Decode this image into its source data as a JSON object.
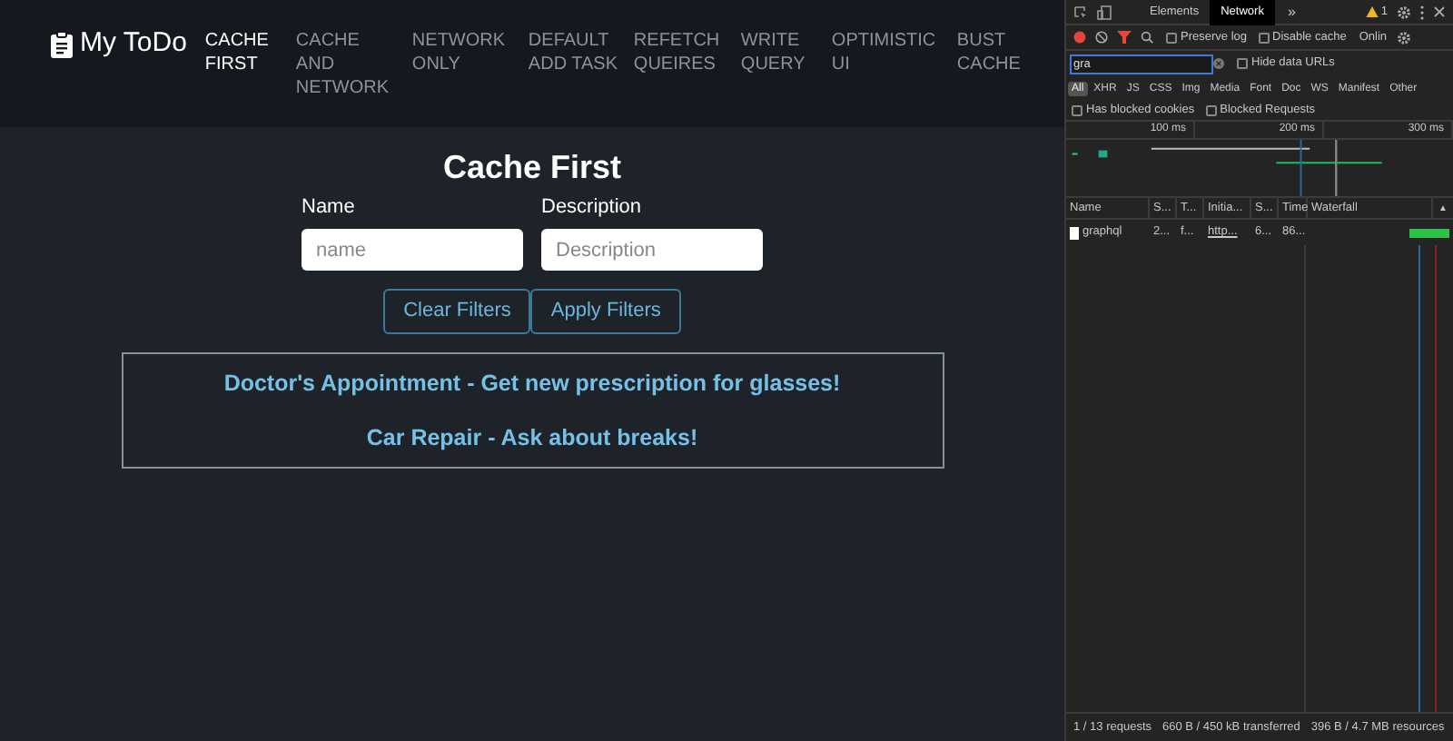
{
  "app": {
    "brand": "My ToDo",
    "nav": [
      {
        "label": "CACHE FIRST",
        "selected": true
      },
      {
        "label": "CACHE AND NETWORK",
        "selected": false
      },
      {
        "label": "NETWORK ONLY",
        "selected": false
      },
      {
        "label": "DEFAULT ADD TASK",
        "selected": false
      },
      {
        "label": "REFETCH QUEIRES",
        "selected": false
      },
      {
        "label": "WRITE QUERY",
        "selected": false
      },
      {
        "label": "OPTIMISTIC UI",
        "selected": false
      },
      {
        "label": "BUST CACHE",
        "selected": false
      }
    ],
    "heading": "Cache First",
    "fields": [
      {
        "label": "Name",
        "placeholder": "name"
      },
      {
        "label": "Description",
        "placeholder": "Description"
      }
    ],
    "buttons": [
      "Clear Filters",
      "Apply Filters"
    ],
    "tasks": [
      "Doctor's Appointment - Get new prescription for glasses!",
      "Car Repair - Ask about breaks!"
    ]
  },
  "devtools": {
    "tabs": [
      {
        "label": "Elements",
        "selected": false
      },
      {
        "label": "Network",
        "selected": true
      }
    ],
    "more": "»",
    "warnings": "1",
    "options": [
      {
        "label": "Preserve log",
        "checked": false
      },
      {
        "label": "Disable cache",
        "checked": false
      }
    ],
    "throttle": "Onlin",
    "filter": {
      "value": "gra"
    },
    "hide_data_urls": {
      "label": "Hide data URLs",
      "checked": false
    },
    "types": [
      {
        "label": "All",
        "selected": true
      },
      {
        "label": "XHR",
        "selected": false
      },
      {
        "label": "JS",
        "selected": false
      },
      {
        "label": "CSS",
        "selected": false
      },
      {
        "label": "Img",
        "selected": false
      },
      {
        "label": "Media",
        "selected": false
      },
      {
        "label": "Font",
        "selected": false
      },
      {
        "label": "Doc",
        "selected": false
      },
      {
        "label": "WS",
        "selected": false
      },
      {
        "label": "Manifest",
        "selected": false
      },
      {
        "label": "Other",
        "selected": false
      }
    ],
    "blocked": [
      {
        "label": "Has blocked cookies",
        "checked": false
      },
      {
        "label": "Blocked Requests",
        "checked": false
      }
    ],
    "ticks": [
      "100 ms",
      "200 ms",
      "300 ms"
    ],
    "columns": [
      "Name",
      "S...",
      "T...",
      "Initia...",
      "S...",
      "Time",
      "Waterfall"
    ],
    "sort_mark": "▲",
    "rows": [
      [
        "graphql",
        "2...",
        "f...",
        "http...",
        "6...",
        "86..."
      ]
    ],
    "status": [
      "1 / 13 requests",
      "660 B / 450 kB transferred",
      "396 B / 4.7 MB resources"
    ]
  }
}
